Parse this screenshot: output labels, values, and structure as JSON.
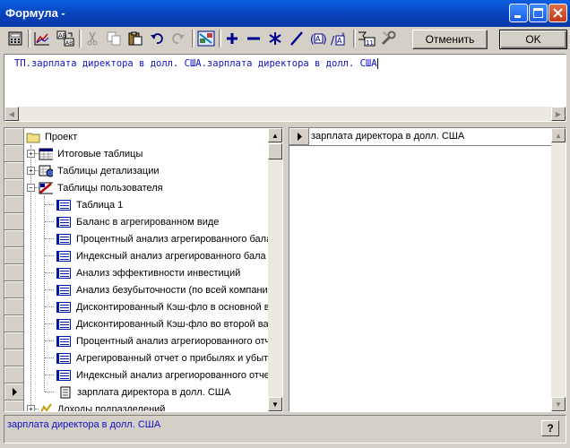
{
  "window": {
    "title": "Формула -",
    "controls": {
      "minimize": "minimize-icon",
      "maximize": "maximize-icon",
      "close": "close-icon"
    }
  },
  "toolbar": {
    "icons": [
      "calculator-icon",
      "chart-icon",
      "swap-icon",
      "cut-icon",
      "copy-icon",
      "paste-icon",
      "undo-icon",
      "redo-icon",
      "function-icon",
      "plus-icon",
      "minus-icon",
      "multiply-icon",
      "divide-icon",
      "parentheses-icon",
      "power-icon",
      "filter-icon",
      "wrench-icon"
    ],
    "cancel_label": "Отменить",
    "ok_label": "OK"
  },
  "formula": {
    "text": "ТП.зарплата директора в долл. США.зарплата директора в долл. США"
  },
  "tree": {
    "root_label": "Проект",
    "items": [
      {
        "label": "Итоговые таблицы",
        "icon": "table-icon"
      },
      {
        "label": "Таблицы детализации",
        "icon": "table-link-icon"
      },
      {
        "label": "Таблицы пользователя",
        "icon": "user-table-icon"
      },
      {
        "label": "Таблица 1",
        "icon": "report-icon"
      },
      {
        "label": "Баланс в агрегированном виде",
        "icon": "report-icon"
      },
      {
        "label": "Процентный анализ агрегированного бала",
        "icon": "report-icon"
      },
      {
        "label": "Индексный анализ агрегированного бала",
        "icon": "report-icon"
      },
      {
        "label": "Анализ эффективности инвестиций",
        "icon": "report-icon"
      },
      {
        "label": "Анализ безубыточности (по всей компани",
        "icon": "report-icon"
      },
      {
        "label": "Дисконтированный Кэш-фло в основной в",
        "icon": "report-icon"
      },
      {
        "label": "Дисконтированный Кэш-фло во второй ва",
        "icon": "report-icon"
      },
      {
        "label": "Процентный анализ агрегиорованного отч",
        "icon": "report-icon"
      },
      {
        "label": "Агрегированный отчет о прибылях и убытк",
        "icon": "report-icon"
      },
      {
        "label": "Индексный анализ агрегиорованного отче",
        "icon": "report-icon"
      },
      {
        "label": "зарплата директора в долл. США",
        "icon": "page-icon"
      },
      {
        "label": "Доходы подразделений",
        "icon": "income-icon"
      }
    ]
  },
  "right_panel": {
    "item": "зарплата директора в долл. США"
  },
  "status": {
    "text": "зарплата директора в долл. США",
    "help": "?"
  },
  "colors": {
    "titlebar": "#0a4ed0",
    "formula_text": "#1010c8",
    "face": "#d4d0c8"
  }
}
